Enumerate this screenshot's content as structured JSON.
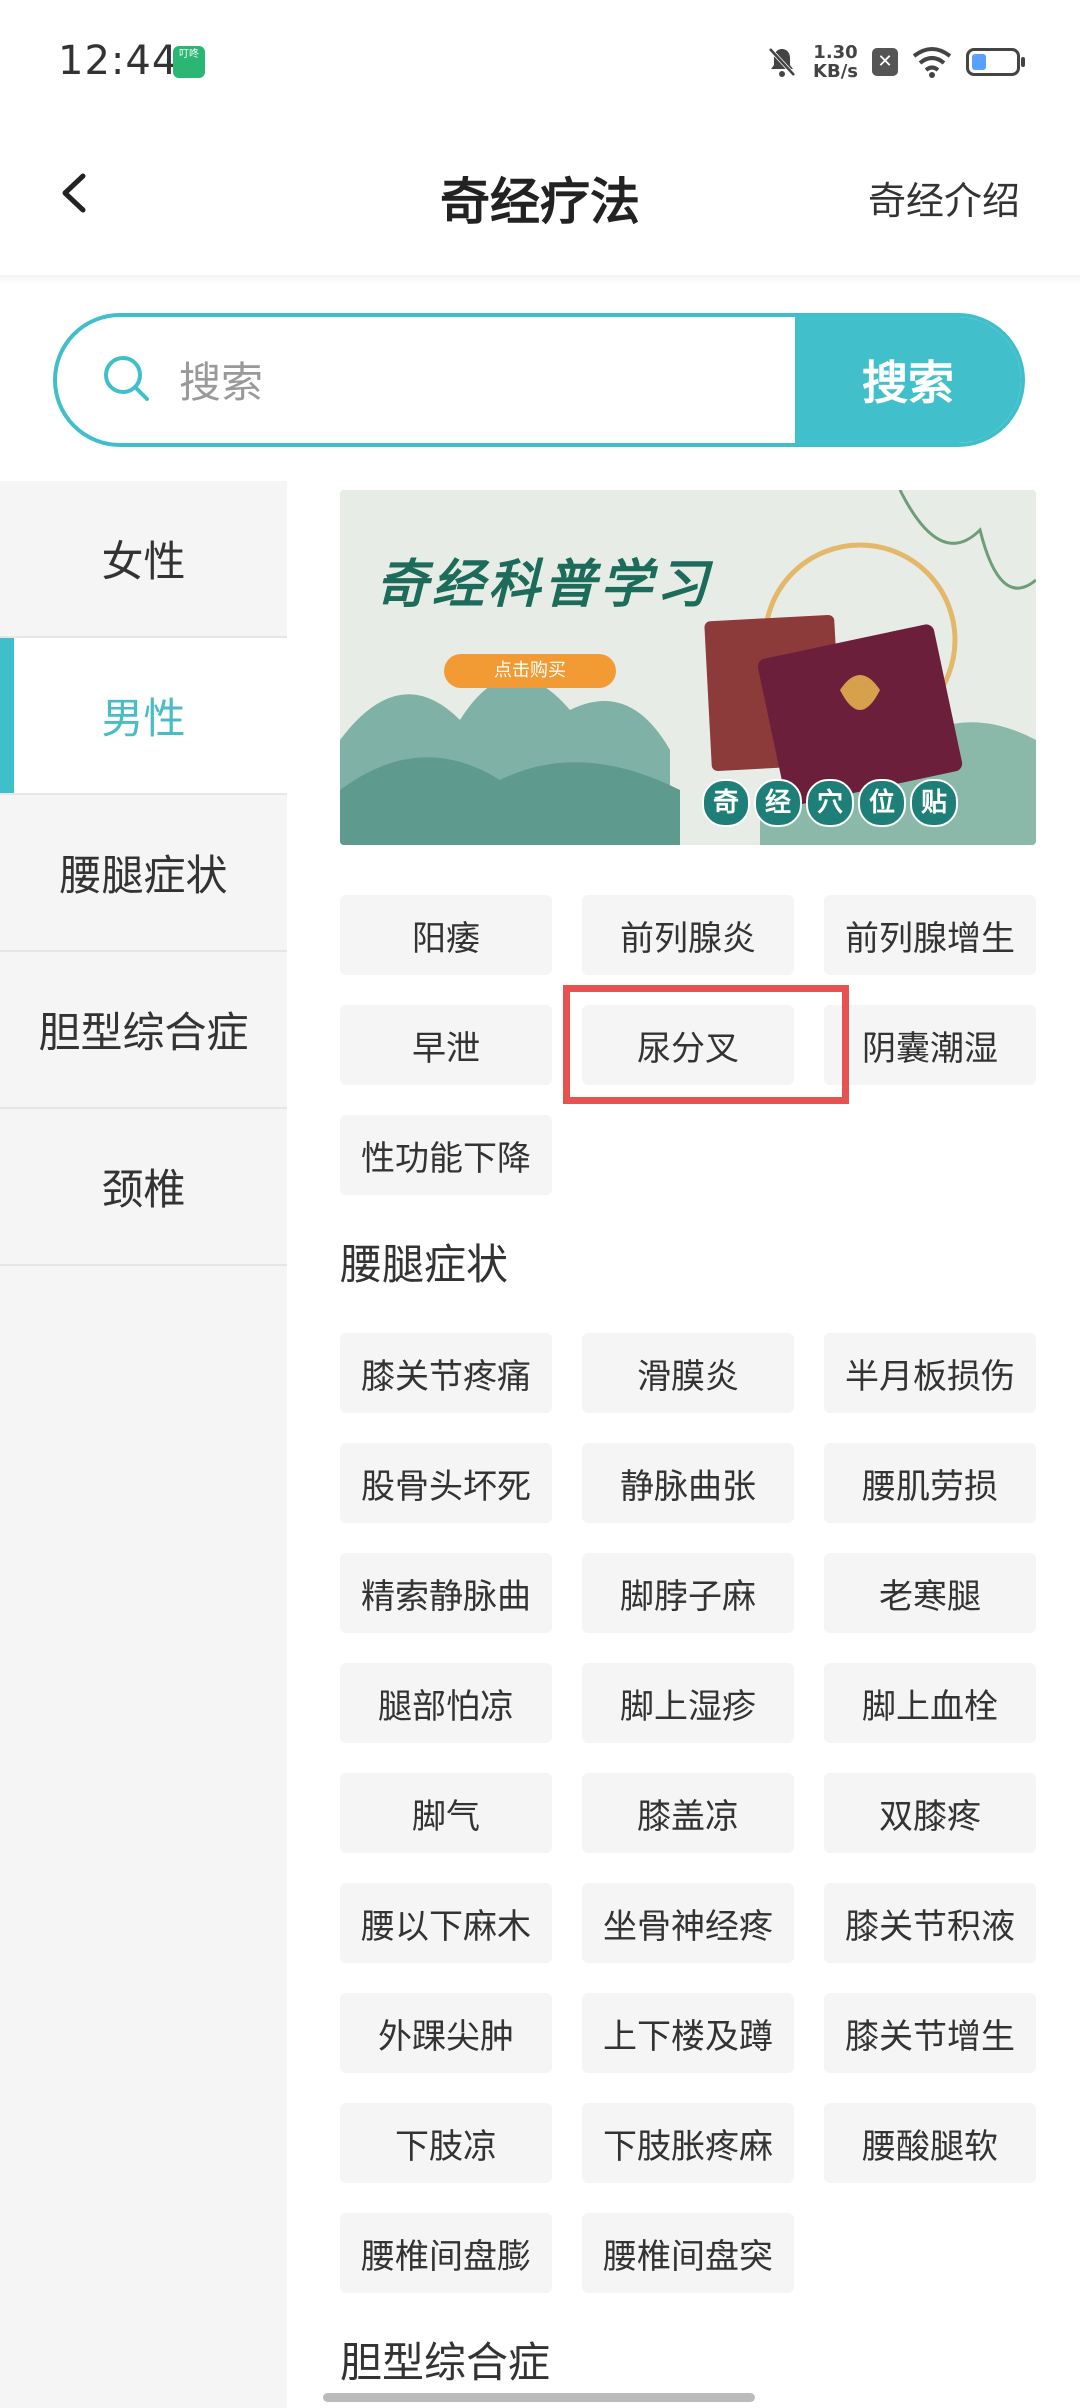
{
  "status_bar": {
    "time": "12:44",
    "app_badge": "叮咚",
    "net_speed": "1.30",
    "net_unit": "KB/s"
  },
  "header": {
    "title": "奇经疗法",
    "right_link": "奇经介绍"
  },
  "search": {
    "placeholder": "搜索",
    "button": "搜索"
  },
  "sidebar": {
    "items": [
      {
        "label": "女性"
      },
      {
        "label": "男性",
        "active": true
      },
      {
        "label": "腰腿症状"
      },
      {
        "label": "胆型综合症"
      },
      {
        "label": "颈椎"
      }
    ]
  },
  "banner": {
    "title": "奇经科普学习",
    "button": "点击购买",
    "badge": [
      "奇",
      "经",
      "穴",
      "位",
      "贴"
    ]
  },
  "male_tags": [
    "阳痿",
    "前列腺炎",
    "前列腺增生",
    "早泄",
    "尿分叉",
    "阴囊潮湿",
    "性功能下降"
  ],
  "sections": [
    {
      "title": "腰腿症状",
      "tags": [
        "膝关节疼痛",
        "滑膜炎",
        "半月板损伤",
        "股骨头坏死",
        "静脉曲张",
        "腰肌劳损",
        "精索静脉曲",
        "脚脖子麻",
        "老寒腿",
        "腿部怕凉",
        "脚上湿疹",
        "脚上血栓",
        "脚气",
        "膝盖凉",
        "双膝疼",
        "腰以下麻木",
        "坐骨神经疼",
        "膝关节积液",
        "外踝尖肿",
        "上下楼及蹲",
        "膝关节增生",
        "下肢凉",
        "下肢胀疼麻",
        "腰酸腿软",
        "腰椎间盘膨",
        "腰椎间盘突"
      ]
    },
    {
      "title": "胆型综合症"
    }
  ],
  "colors": {
    "accent": "#3fbfca",
    "highlight": "#e5524f"
  }
}
